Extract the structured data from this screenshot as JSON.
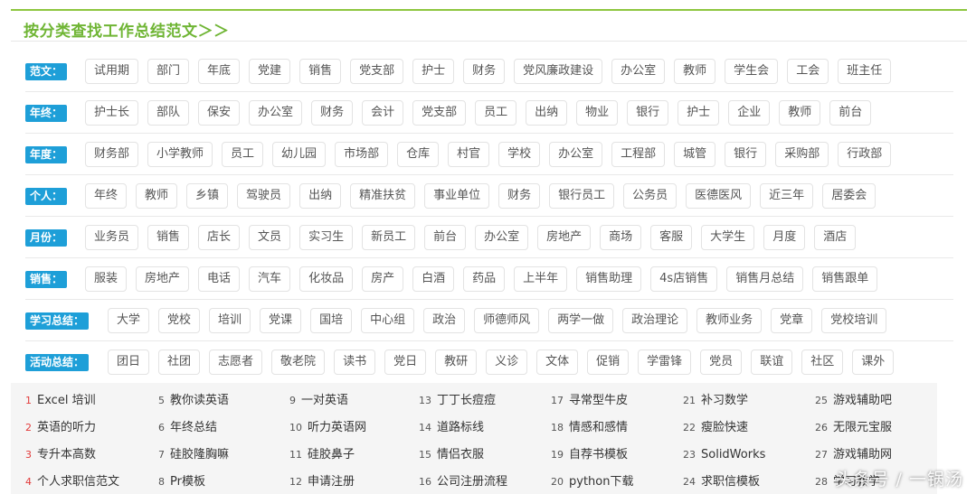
{
  "header": {
    "title": "按分类查找工作总结范文＞＞"
  },
  "categories": [
    {
      "label": "范文：",
      "tags": [
        "试用期",
        "部门",
        "年底",
        "党建",
        "销售",
        "党支部",
        "护士",
        "财务",
        "党风廉政建设",
        "办公室",
        "教师",
        "学生会",
        "工会",
        "班主任"
      ]
    },
    {
      "label": "年终：",
      "tags": [
        "护士长",
        "部队",
        "保安",
        "办公室",
        "财务",
        "会计",
        "党支部",
        "员工",
        "出纳",
        "物业",
        "银行",
        "护士",
        "企业",
        "教师",
        "前台"
      ]
    },
    {
      "label": "年度：",
      "tags": [
        "财务部",
        "小学教师",
        "员工",
        "幼儿园",
        "市场部",
        "仓库",
        "村官",
        "学校",
        "办公室",
        "工程部",
        "城管",
        "银行",
        "采购部",
        "行政部"
      ]
    },
    {
      "label": "个人：",
      "tags": [
        "年终",
        "教师",
        "乡镇",
        "驾驶员",
        "出纳",
        "精准扶贫",
        "事业单位",
        "财务",
        "银行员工",
        "公务员",
        "医德医风",
        "近三年",
        "居委会"
      ]
    },
    {
      "label": "月份：",
      "tags": [
        "业务员",
        "销售",
        "店长",
        "文员",
        "实习生",
        "新员工",
        "前台",
        "办公室",
        "房地产",
        "商场",
        "客服",
        "大学生",
        "月度",
        "酒店"
      ]
    },
    {
      "label": "销售：",
      "tags": [
        "服装",
        "房地产",
        "电话",
        "汽车",
        "化妆品",
        "房产",
        "白酒",
        "药品",
        "上半年",
        "销售助理",
        "4s店销售",
        "销售月总结",
        "销售跟单"
      ]
    },
    {
      "label": "学习总结：",
      "tags": [
        "大学",
        "党校",
        "培训",
        "党课",
        "国培",
        "中心组",
        "政治",
        "师德师风",
        "两学一做",
        "政治理论",
        "教师业务",
        "党章",
        "党校培训"
      ]
    },
    {
      "label": "活动总结：",
      "tags": [
        "团日",
        "社团",
        "志愿者",
        "敬老院",
        "读书",
        "党日",
        "教研",
        "义诊",
        "文体",
        "促销",
        "学雷锋",
        "党员",
        "联谊",
        "社区",
        "课外"
      ]
    }
  ],
  "hot_list": [
    [
      {
        "num": "1",
        "text": "Excel 培训"
      },
      {
        "num": "2",
        "text": "英语的听力"
      },
      {
        "num": "3",
        "text": "专升本高数"
      },
      {
        "num": "4",
        "text": "个人求职信范文"
      }
    ],
    [
      {
        "num": "5",
        "text": "教你读英语"
      },
      {
        "num": "6",
        "text": "年终总结"
      },
      {
        "num": "7",
        "text": "硅胶隆胸嘛"
      },
      {
        "num": "8",
        "text": "Pr模板"
      }
    ],
    [
      {
        "num": "9",
        "text": "一对英语"
      },
      {
        "num": "10",
        "text": "听力英语网"
      },
      {
        "num": "11",
        "text": "硅胶鼻子"
      },
      {
        "num": "12",
        "text": "申请注册"
      }
    ],
    [
      {
        "num": "13",
        "text": "丁丁长痘痘"
      },
      {
        "num": "14",
        "text": "道路标线"
      },
      {
        "num": "15",
        "text": "情侣衣服"
      },
      {
        "num": "16",
        "text": "公司注册流程"
      }
    ],
    [
      {
        "num": "17",
        "text": "寻常型牛皮"
      },
      {
        "num": "18",
        "text": "情感和感情"
      },
      {
        "num": "19",
        "text": "自荐书模板"
      },
      {
        "num": "20",
        "text": "python下载"
      }
    ],
    [
      {
        "num": "21",
        "text": "补习数学"
      },
      {
        "num": "22",
        "text": "瘦脸快速"
      },
      {
        "num": "23",
        "text": "SolidWorks"
      },
      {
        "num": "24",
        "text": "求职信模板"
      }
    ],
    [
      {
        "num": "25",
        "text": "游戏辅助吧"
      },
      {
        "num": "26",
        "text": "无限元宝服"
      },
      {
        "num": "27",
        "text": "游戏辅助网"
      },
      {
        "num": "28",
        "text": "学习教学"
      }
    ]
  ],
  "watermark": "头条号 / 一锅汤",
  "colors": {
    "accent_green": "#6fb534",
    "label_blue": "#1e9fd8",
    "hot_red": "#e23a3a"
  }
}
